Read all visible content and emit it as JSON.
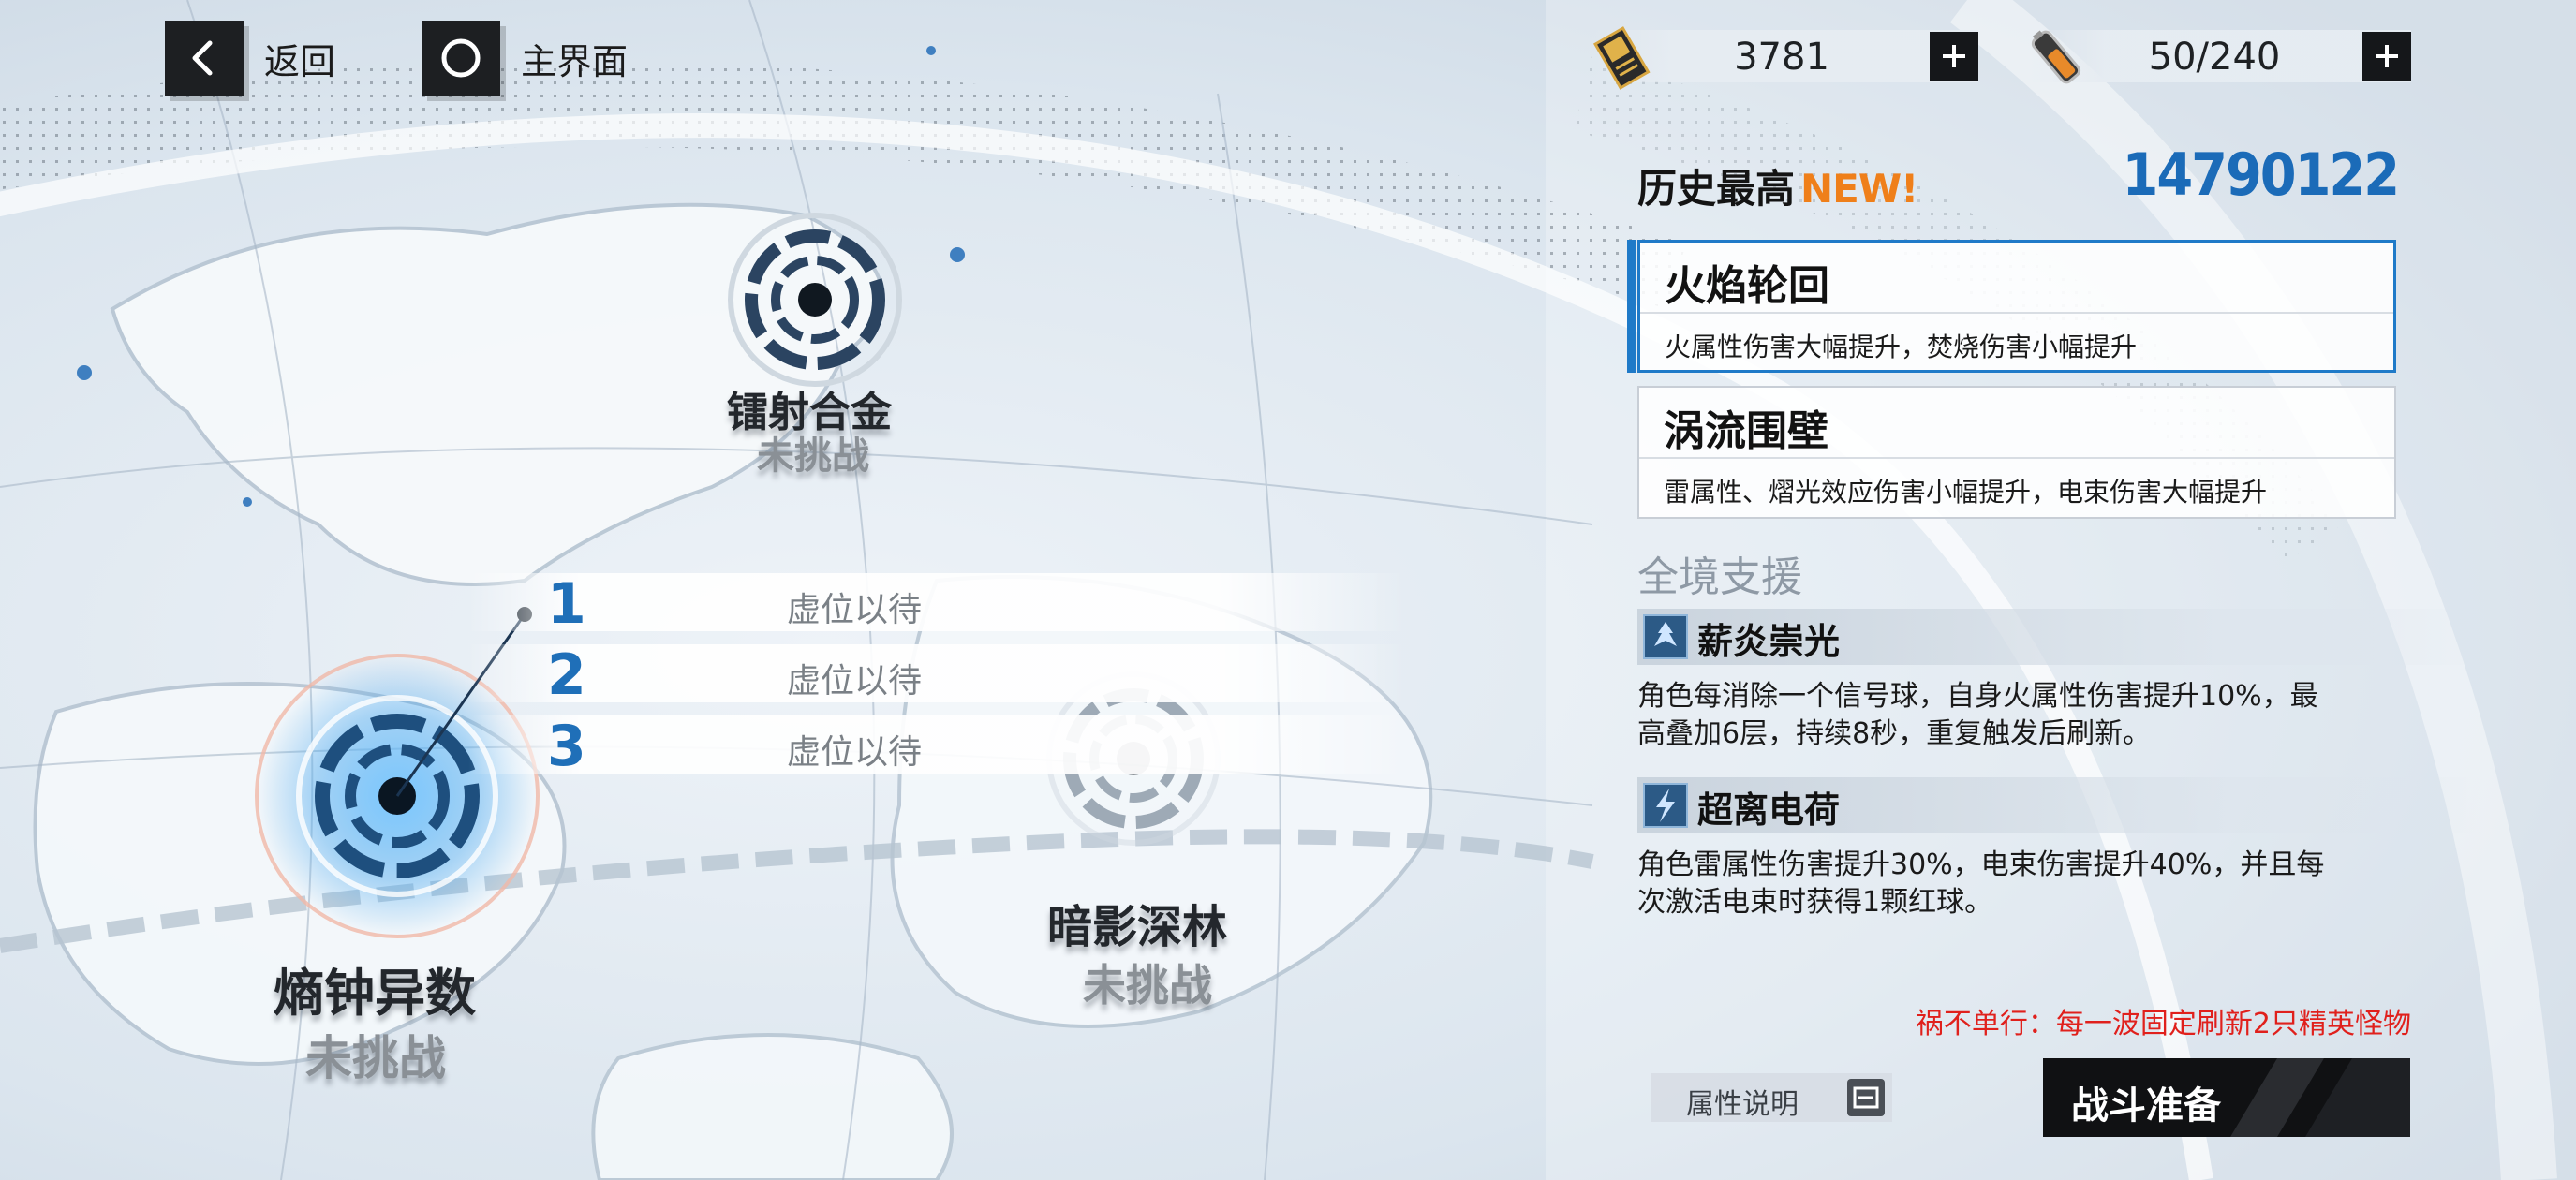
{
  "header": {
    "back_label": "返回",
    "main_label": "主界面",
    "resources": [
      {
        "icon": "ticket-icon",
        "value": "3781"
      },
      {
        "icon": "battery-icon",
        "value": "50/240"
      }
    ]
  },
  "record": {
    "label": "历史最高",
    "new_badge": "NEW!",
    "score": "14790122"
  },
  "buffs": [
    {
      "title": "火焰轮回",
      "desc": "火属性伤害大幅提升，焚烧伤害小幅提升",
      "selected": true
    },
    {
      "title": "涡流围壁",
      "desc": "雷属性、熠光效应伤害小幅提升，电束伤害大幅提升",
      "selected": false
    }
  ],
  "support": {
    "title": "全境支援",
    "skills": [
      {
        "name": "薪炎崇光",
        "desc_line1": "角色每消除一个信号球，自身火属性伤害提升10%，最",
        "desc_line2": "高叠加6层，持续8秒，重复触发后刷新。"
      },
      {
        "name": "超离电荷",
        "desc_line1": "角色雷属性伤害提升30%，电束伤害提升40%，并且每",
        "desc_line2": "次激活电束时获得1颗红球。"
      }
    ]
  },
  "warning": "祸不单行：每一波固定刷新2只精英怪物",
  "attr_button": "属性说明",
  "battle_button": "战斗准备",
  "map": {
    "nodes": [
      {
        "name": "镭射合金",
        "status": "未挑战"
      },
      {
        "name": "熵钟异数",
        "status": "未挑战"
      },
      {
        "name": "暗影深林",
        "status": "未挑战"
      }
    ],
    "slots": [
      {
        "num": "1",
        "text": "虚位以待"
      },
      {
        "num": "2",
        "text": "虚位以待"
      },
      {
        "num": "3",
        "text": "虚位以待"
      }
    ]
  },
  "colors": {
    "accent_blue": "#1f7ac8",
    "score_blue": "#1b6bb8",
    "new_orange": "#ef7f1a",
    "warning_red": "#e0201c"
  }
}
